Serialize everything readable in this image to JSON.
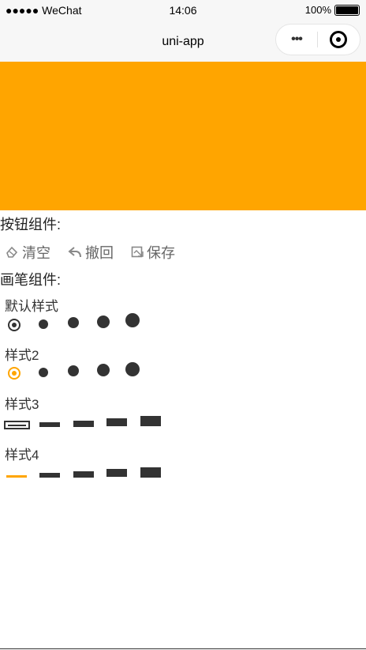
{
  "status_bar": {
    "carrier": "●●●●● WeChat",
    "time": "14:06",
    "battery": "100%"
  },
  "nav": {
    "title": "uni-app",
    "more_label": "•••"
  },
  "canvas": {
    "color": "#ffa500"
  },
  "button_section": {
    "title": "按钮组件:",
    "buttons": [
      {
        "label": "清空",
        "icon": "eraser-icon"
      },
      {
        "label": "撤回",
        "icon": "undo-icon"
      },
      {
        "label": "保存",
        "icon": "save-icon"
      }
    ]
  },
  "pen_section": {
    "title": "画笔组件:",
    "styles": [
      {
        "label": "默认样式",
        "selected_index": 0,
        "kind": "dot"
      },
      {
        "label": "样式2",
        "selected_index": 0,
        "kind": "dot",
        "accent": "#ffa500"
      },
      {
        "label": "样式3",
        "selected_index": 0,
        "kind": "bar"
      },
      {
        "label": "样式4",
        "selected_index": 0,
        "kind": "bar",
        "accent": "#ffa500"
      }
    ]
  }
}
